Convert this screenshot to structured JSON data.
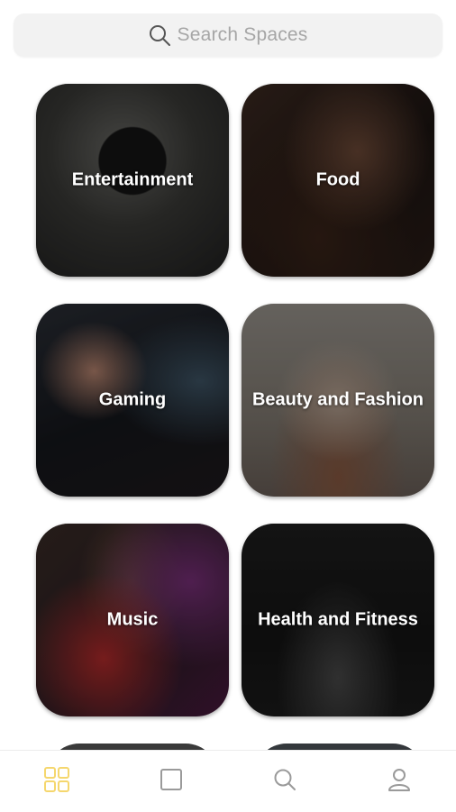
{
  "search": {
    "placeholder": "Search Spaces",
    "icon": "search-icon"
  },
  "spaces": [
    {
      "label": "Entertainment",
      "image": "camera-on-tripod-photo"
    },
    {
      "label": "Food",
      "image": "person-eating-photo"
    },
    {
      "label": "Gaming",
      "image": "gamer-at-pc-photo"
    },
    {
      "label": "Beauty and Fashion",
      "image": "fashion-model-photo"
    },
    {
      "label": "Music",
      "image": "musician-with-headphones-photo"
    },
    {
      "label": "Health and Fitness",
      "image": "weightlifter-photo"
    }
  ],
  "tabbar": {
    "items": [
      {
        "icon": "grid-icon",
        "active": true
      },
      {
        "icon": "square-icon",
        "active": false
      },
      {
        "icon": "search-icon",
        "active": false
      },
      {
        "icon": "profile-icon",
        "active": false
      }
    ],
    "active_color": "#f5d76e",
    "inactive_color": "#9a9a9a"
  }
}
